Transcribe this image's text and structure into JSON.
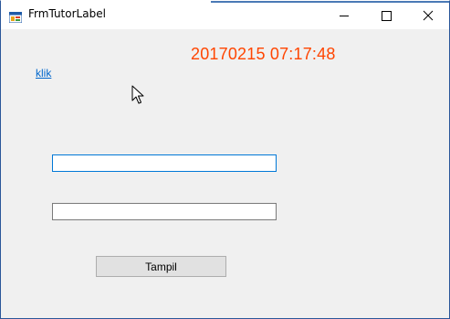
{
  "window": {
    "title": "FrmTutorLabel",
    "icon": "form-icon",
    "controls": {
      "minimize_icon": "minimize-icon",
      "maximize_icon": "maximize-icon",
      "close_icon": "close-icon"
    }
  },
  "form": {
    "clock_text": "20170215 07:17:48",
    "clock_color": "#ff4500",
    "link_text": "klik",
    "link_color": "#0066cc",
    "textbox1": {
      "value": "",
      "placeholder": ""
    },
    "textbox2": {
      "value": "",
      "placeholder": ""
    },
    "button_label": "Tampil"
  },
  "colors": {
    "form_background": "#f0f0f0",
    "focus_border": "#0078d7"
  }
}
